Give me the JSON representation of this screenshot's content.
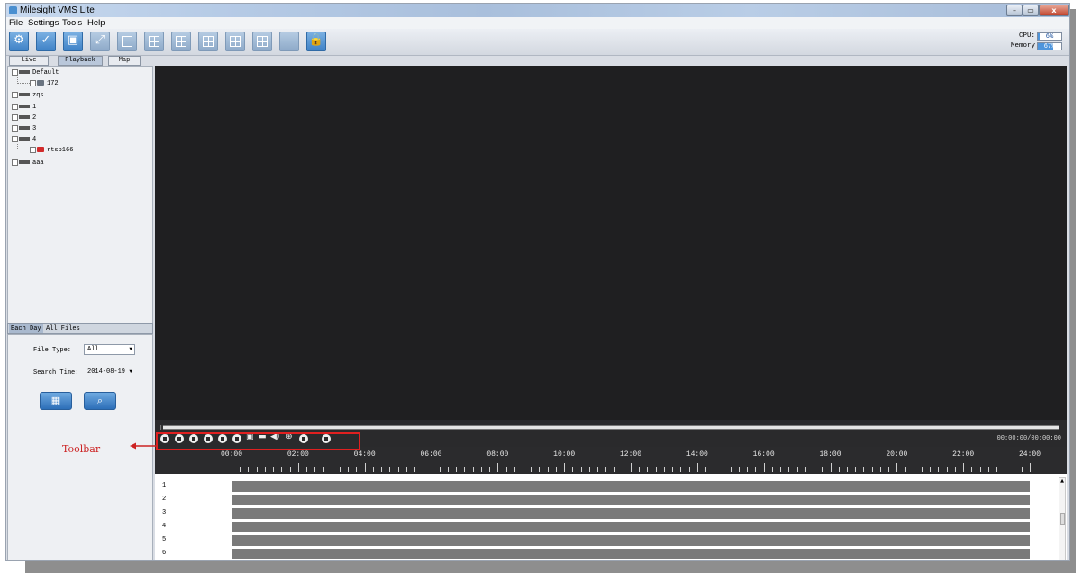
{
  "window": {
    "title": "Milesight VMS Lite",
    "controls": {
      "minimize": "–",
      "maximize": "▭",
      "close": "x"
    }
  },
  "menu": [
    "File",
    "Settings",
    "Tools",
    "Help"
  ],
  "toolbar": {
    "buttons": [
      "settings-icon",
      "check-icon",
      "playback-icon",
      "fullscreen-icon",
      "layout-1-icon",
      "layout-4-icon",
      "layout-6-icon",
      "layout-9-icon",
      "layout-16-icon",
      "layout-25-icon",
      "blank-icon",
      "lock-icon"
    ],
    "lock_symbol": "🔒",
    "cpu_label": "CPU:",
    "cpu_value": "6%",
    "cpu_level": 0.06,
    "memory_label": "Memory",
    "memory_value": "67%",
    "memory_level": 0.67
  },
  "left_tabs": {
    "live": "Live",
    "playback": "Playback",
    "map": "Map"
  },
  "tree": [
    {
      "label": "Default",
      "type": "group"
    },
    {
      "label": "172",
      "type": "camera"
    },
    {
      "label": "zqs",
      "type": "group"
    },
    {
      "label": "1",
      "type": "group"
    },
    {
      "label": "2",
      "type": "group"
    },
    {
      "label": "3",
      "type": "group"
    },
    {
      "label": "4",
      "type": "group"
    },
    {
      "label": "rtsp166",
      "type": "camera-red"
    },
    {
      "label": "aaa",
      "type": "group"
    }
  ],
  "search": {
    "tab_each_day": "Each Day",
    "tab_all_files": "All Files",
    "file_type_label": "File Type:",
    "file_type_value": "All",
    "search_time_label": "Search Time:",
    "search_time_value": "2014-08-19",
    "calendar_symbol": "▦",
    "search_symbol": "⌕"
  },
  "player": {
    "timecode": "00:00:00/00:00:00",
    "seek_progress": 0.0
  },
  "timeline": {
    "hours": [
      "00:00",
      "02:00",
      "04:00",
      "06:00",
      "08:00",
      "10:00",
      "12:00",
      "14:00",
      "16:00",
      "18:00",
      "20:00",
      "22:00",
      "24:00"
    ]
  },
  "channels": [
    "1",
    "2",
    "3",
    "4",
    "5",
    "6"
  ],
  "annotation": {
    "label": "Toolbar",
    "color": "#cc2222"
  },
  "colors": {
    "video_bg": "#1f1f21",
    "toolbar_blue": "#3f82c7",
    "highlight": "#e02020"
  }
}
